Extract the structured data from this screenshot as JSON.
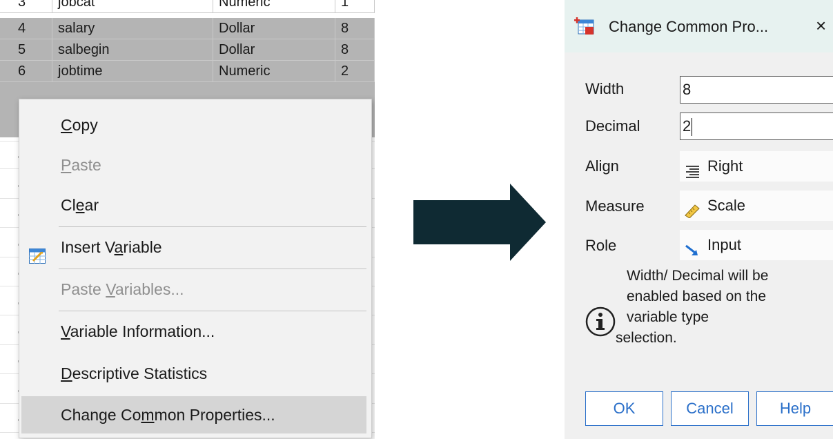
{
  "grid": {
    "rows": [
      {
        "num": "3",
        "name": "jobcat",
        "type": "Numeric",
        "width": "1"
      },
      {
        "num": "4",
        "name": "salary",
        "type": "Dollar",
        "width": "8"
      },
      {
        "num": "5",
        "name": "salbegin",
        "type": "Dollar",
        "width": "8"
      },
      {
        "num": "6",
        "name": "jobtime",
        "type": "Numeric",
        "width": "2"
      }
    ]
  },
  "context_menu": {
    "items": [
      {
        "label": "Copy",
        "mnemonic_index": 0,
        "enabled": true
      },
      {
        "label": "Paste",
        "mnemonic_index": 0,
        "enabled": false
      },
      {
        "label": "Clear",
        "mnemonic_index": 2,
        "enabled": true
      },
      {
        "label": "Insert Variable",
        "mnemonic_index": 8,
        "enabled": true,
        "icon": "insert-variable-icon"
      },
      {
        "label": "Paste Variables...",
        "mnemonic_index": 6,
        "enabled": false
      },
      {
        "label": "Variable Information...",
        "mnemonic_index": 0,
        "enabled": true
      },
      {
        "label": "Descriptive Statistics",
        "mnemonic_index": 0,
        "enabled": true
      },
      {
        "label": "Change Common Properties...",
        "mnemonic_index": 9,
        "enabled": true,
        "highlighted": true
      }
    ]
  },
  "dialog": {
    "title": "Change Common Pro...",
    "close": "×",
    "width_label": "Width",
    "width_value": "8",
    "decimal_label": "Decimal",
    "decimal_value": "2",
    "align_label": "Align",
    "align_value": "Right",
    "measure_label": "Measure",
    "measure_value": "Scale",
    "role_label": "Role",
    "role_value": "Input",
    "info_lines": [
      "Width/ Decimal will be",
      "enabled based on the",
      "variable type",
      "selection."
    ],
    "ok_label": "OK",
    "cancel_label": "Cancel",
    "help_label": "Help"
  },
  "colors": {
    "selected_row": "#b4b4b4",
    "menu_bg": "#f2f2f2",
    "menu_highlight": "#d5d5d5",
    "arrow": "#0f2a33",
    "dialog_title_bg": "#e7f2f0",
    "button_accent": "#2a6fc9"
  }
}
